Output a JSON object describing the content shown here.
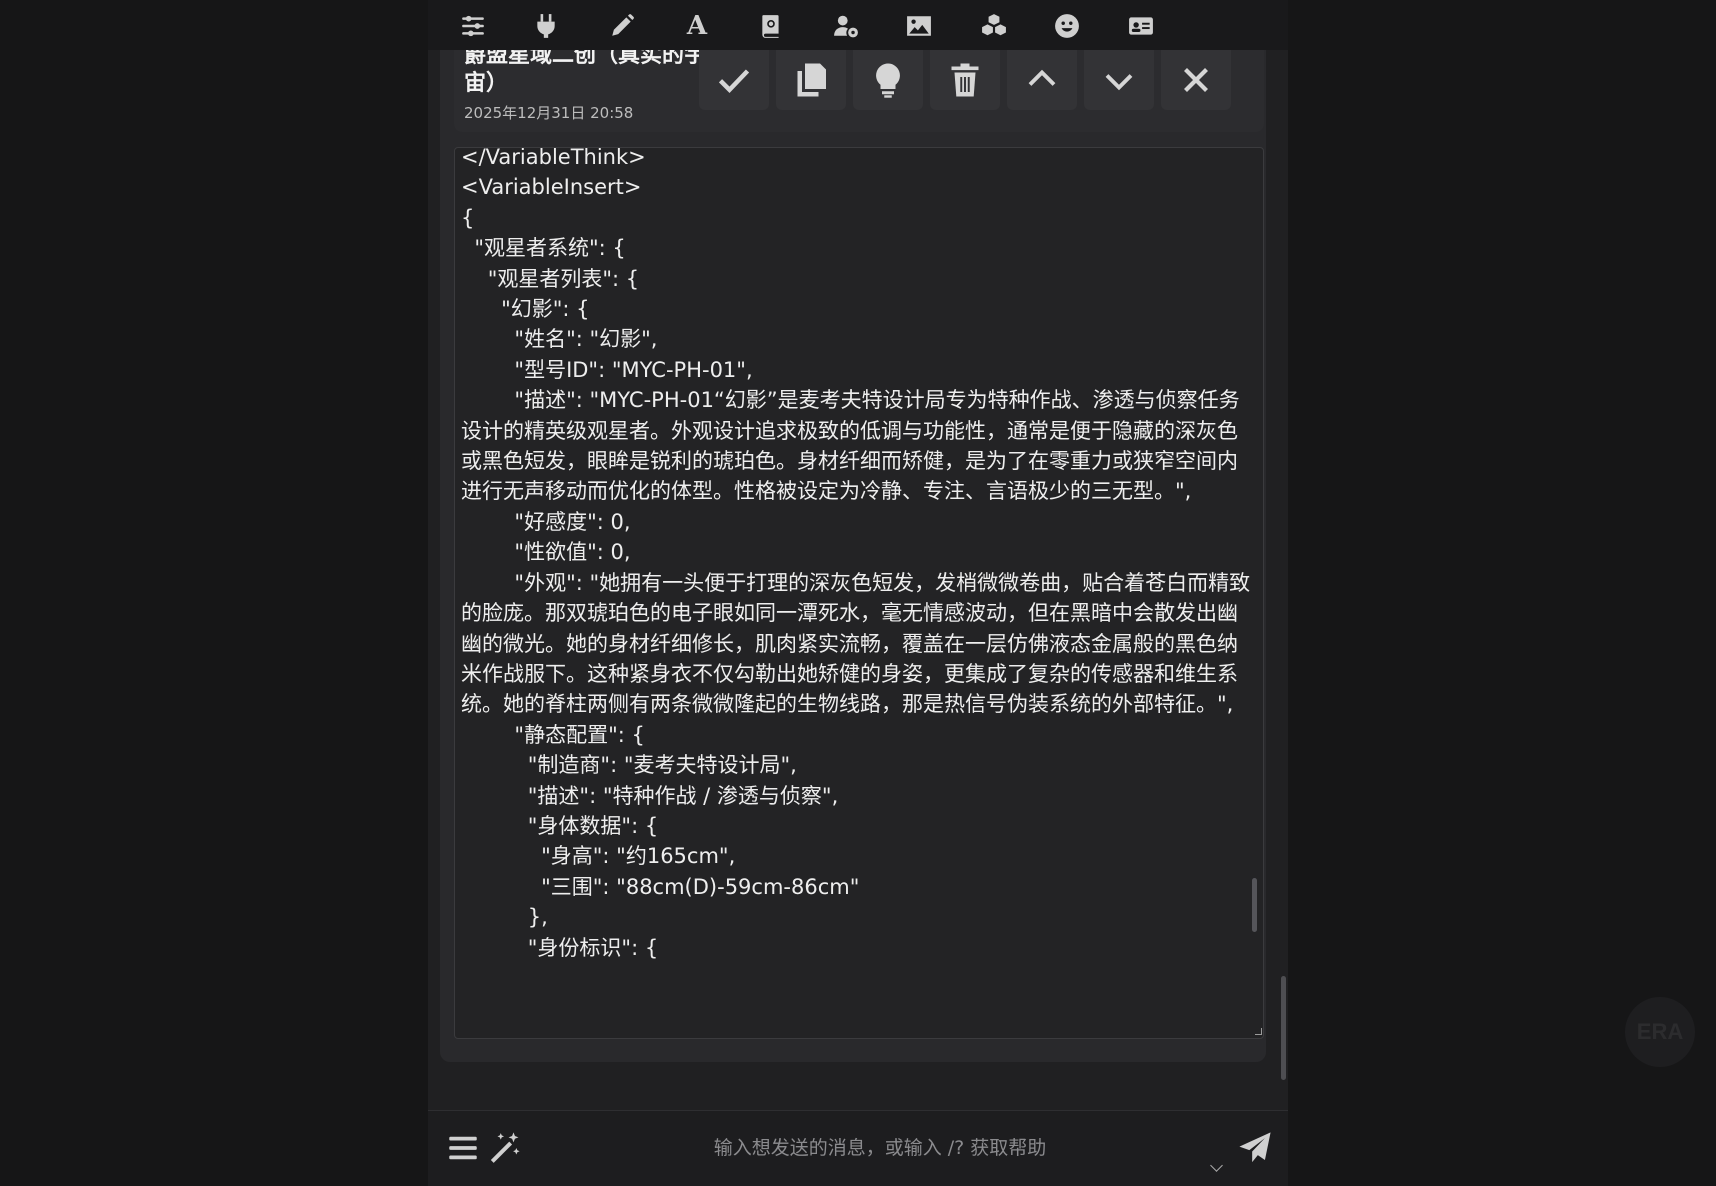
{
  "toolbar": {
    "icons": [
      "sliders-icon",
      "plug-icon",
      "pencil-icon",
      "font-icon",
      "book-icon",
      "user-gear-icon",
      "image-icon",
      "cubes-icon",
      "smile-icon",
      "id-card-icon"
    ],
    "font_glyph": "A"
  },
  "message": {
    "title": "爵盟星域二创（真实的宇\n宙）",
    "timestamp": "2025年12月31日 20:58",
    "actions": [
      "check-icon",
      "copy-icon",
      "lightbulb-icon",
      "trash-icon",
      "chevron-up-icon",
      "chevron-down-icon",
      "close-icon"
    ]
  },
  "editor": {
    "content": "</VariableThink>\n<VariableInsert>\n{\n  \"观星者系统\": {\n    \"观星者列表\": {\n      \"幻影\": {\n        \"姓名\": \"幻影\",\n        \"型号ID\": \"MYC-PH-01\",\n        \"描述\": \"MYC-PH-01“幻影”是麦考夫特设计局专为特种作战、渗透与侦察任务设计的精英级观星者。外观设计追求极致的低调与功能性，通常是便于隐藏的深灰色或黑色短发，眼眸是锐利的琥珀色。身材纤细而矫健，是为了在零重力或狭窄空间内进行无声移动而优化的体型。性格被设定为冷静、专注、言语极少的三无型。\",\n        \"好感度\": 0,\n        \"性欲值\": 0,\n        \"外观\": \"她拥有一头便于打理的深灰色短发，发梢微微卷曲，贴合着苍白而精致的脸庞。那双琥珀色的电子眼如同一潭死水，毫无情感波动，但在黑暗中会散发出幽幽的微光。她的身材纤细修长，肌肉紧实流畅，覆盖在一层仿佛液态金属般的黑色纳米作战服下。这种紧身衣不仅勾勒出她矫健的身姿，更集成了复杂的传感器和维生系统。她的脊柱两侧有两条微微隆起的生物线路，那是热信号伪装系统的外部特征。\",\n        \"静态配置\": {\n          \"制造商\": \"麦考夫特设计局\",\n          \"描述\": \"特种作战 / 渗透与侦察\",\n          \"身体数据\": {\n            \"身高\": \"约165cm\",\n            \"三围\": \"88cm(D)-59cm-86cm\"\n          },\n          \"身份标识\": {"
  },
  "input": {
    "placeholder": "输入想发送的消息，或输入 /? 获取帮助"
  },
  "floating": {
    "label": "ERA"
  }
}
